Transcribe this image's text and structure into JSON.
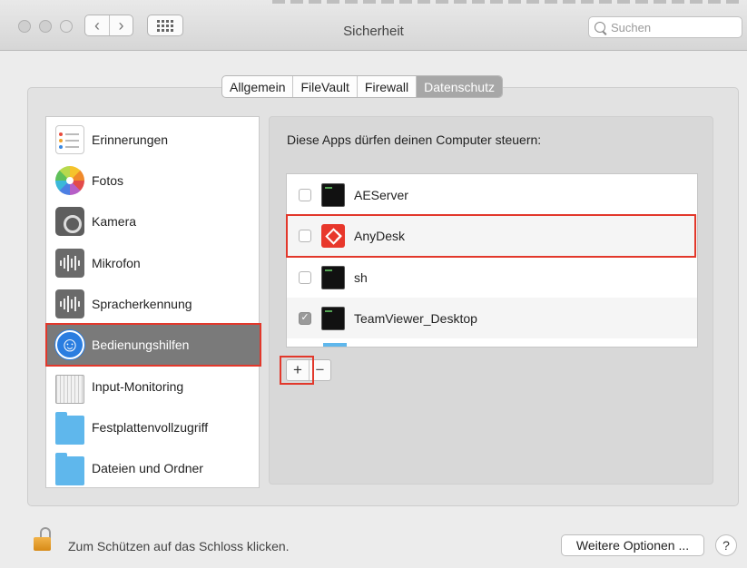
{
  "window": {
    "title": "Sicherheit",
    "search_placeholder": "Suchen",
    "nav_back": "‹",
    "nav_forward": "›"
  },
  "tabs": [
    {
      "label": "Allgemein",
      "active": false
    },
    {
      "label": "FileVault",
      "active": false
    },
    {
      "label": "Firewall",
      "active": false
    },
    {
      "label": "Datenschutz",
      "active": true
    }
  ],
  "privacy_list": [
    {
      "label": "Erinnerungen",
      "icon": "reminders-icon"
    },
    {
      "label": "Fotos",
      "icon": "photos-icon"
    },
    {
      "label": "Kamera",
      "icon": "camera-icon"
    },
    {
      "label": "Mikrofon",
      "icon": "microphone-icon"
    },
    {
      "label": "Spracherkennung",
      "icon": "speech-recognition-icon"
    },
    {
      "label": "Bedienungshilfen",
      "icon": "accessibility-icon",
      "selected": true
    },
    {
      "label": "Input-Monitoring",
      "icon": "keyboard-icon"
    },
    {
      "label": "Festplattenvollzugriff",
      "icon": "folder-icon"
    },
    {
      "label": "Dateien und Ordner",
      "icon": "folder-icon"
    }
  ],
  "apps_panel": {
    "title": "Diese Apps dürfen deinen Computer steuern:",
    "apps": [
      {
        "name": "AEServer",
        "checked": false,
        "icon": "terminal-app-icon"
      },
      {
        "name": "AnyDesk",
        "checked": false,
        "icon": "anydesk-icon"
      },
      {
        "name": "sh",
        "checked": false,
        "icon": "terminal-app-icon"
      },
      {
        "name": "TeamViewer_Desktop",
        "checked": true,
        "icon": "terminal-app-icon"
      }
    ],
    "add_label": "+",
    "remove_label": "−"
  },
  "footer": {
    "lock_text": "Zum Schützen auf das Schloss klicken.",
    "more_options": "Weitere Optionen ...",
    "help": "?"
  },
  "colors": {
    "highlight": "#e2382b",
    "selected_row": "#7a7a7a",
    "active_tab": "#a7a7a7"
  }
}
